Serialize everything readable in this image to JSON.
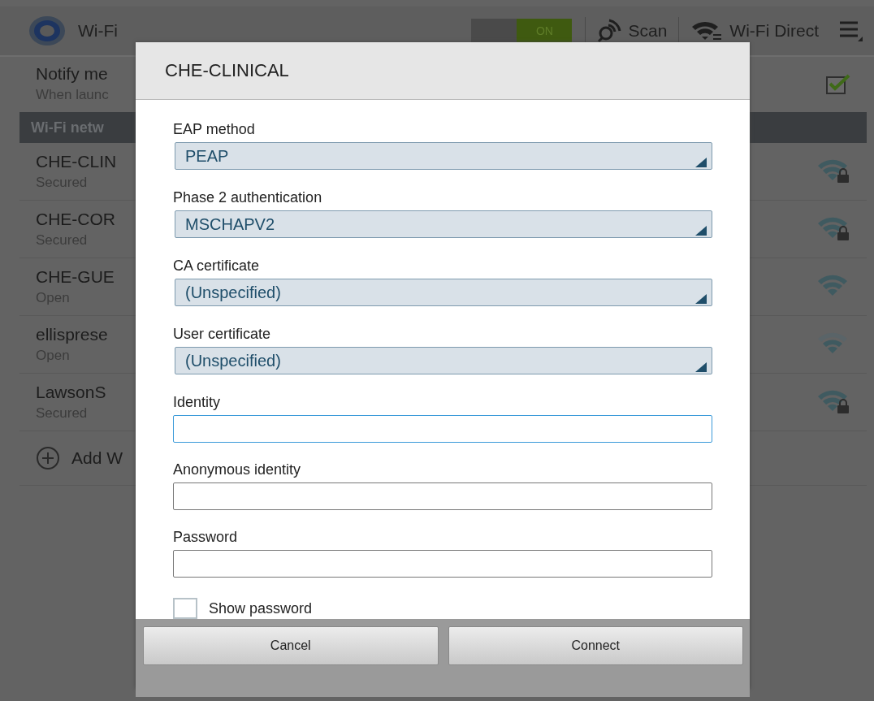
{
  "action_bar": {
    "title": "Wi-Fi",
    "toggle": {
      "label": "ON",
      "on": true
    },
    "actions": [
      {
        "kind": "scan",
        "label": "Scan"
      },
      {
        "kind": "direct",
        "label": "Wi-Fi Direct"
      }
    ]
  },
  "notify": {
    "title": "Notify me",
    "subtitle": "When launc",
    "checked": true
  },
  "section_header": "Wi-Fi netw",
  "networks": [
    {
      "name": "CHE-CLIN",
      "status": "Secured",
      "locked": true,
      "weak": false
    },
    {
      "name": "CHE-COR",
      "status": "Secured",
      "locked": true,
      "weak": false
    },
    {
      "name": "CHE-GUE",
      "status": "Open",
      "locked": false,
      "weak": false
    },
    {
      "name": "ellisprese",
      "status": "Open",
      "locked": false,
      "weak": true
    },
    {
      "name": "LawsonS",
      "status": "Secured",
      "locked": true,
      "weak": false
    }
  ],
  "add_network": "Add W",
  "dialog": {
    "title": "CHE-CLINICAL",
    "fields": [
      {
        "kind": "select",
        "label": "EAP method",
        "value": "PEAP"
      },
      {
        "kind": "select",
        "label": "Phase 2 authentication",
        "value": "MSCHAPV2"
      },
      {
        "kind": "select",
        "label": "CA certificate",
        "value": "(Unspecified)"
      },
      {
        "kind": "select",
        "label": "User certificate",
        "value": "(Unspecified)"
      },
      {
        "kind": "input",
        "label": "Identity",
        "focused": true
      },
      {
        "kind": "input",
        "label": "Anonymous identity",
        "focused": false
      },
      {
        "kind": "input",
        "label": "Password",
        "focused": false
      }
    ],
    "show_password": {
      "label": "Show password",
      "checked": false
    },
    "buttons": [
      "Cancel",
      "Connect"
    ]
  }
}
